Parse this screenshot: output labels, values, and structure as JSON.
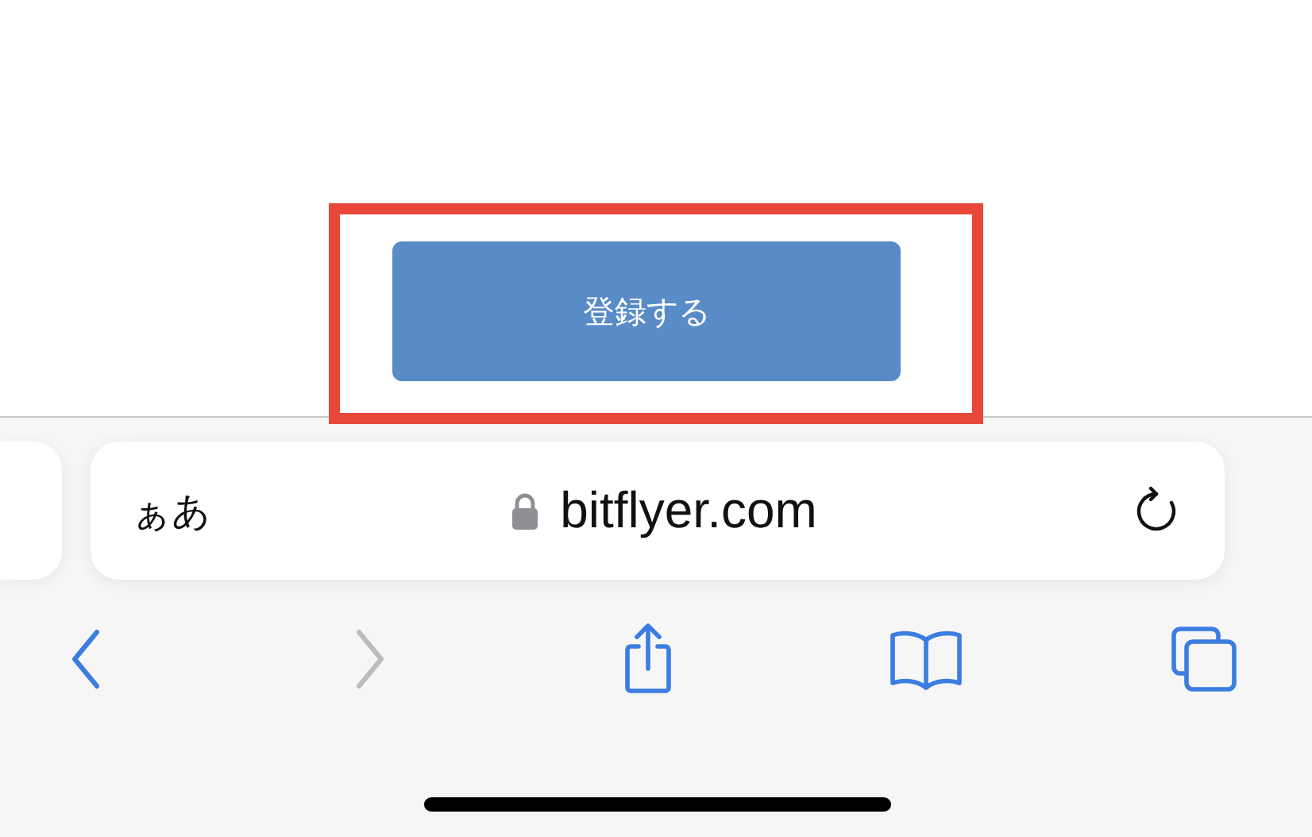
{
  "page": {
    "submit_button": {
      "label": "登録する"
    },
    "highlight": true
  },
  "address_bar": {
    "text_size_button": "ぁあ",
    "secure": true,
    "url": "bitflyer.com"
  },
  "toolbar": [
    {
      "kind": "back",
      "disabled": false
    },
    {
      "kind": "forward",
      "disabled": true
    },
    {
      "kind": "share",
      "disabled": false
    },
    {
      "kind": "bookmarks",
      "disabled": false
    },
    {
      "kind": "tabs",
      "disabled": false
    }
  ]
}
